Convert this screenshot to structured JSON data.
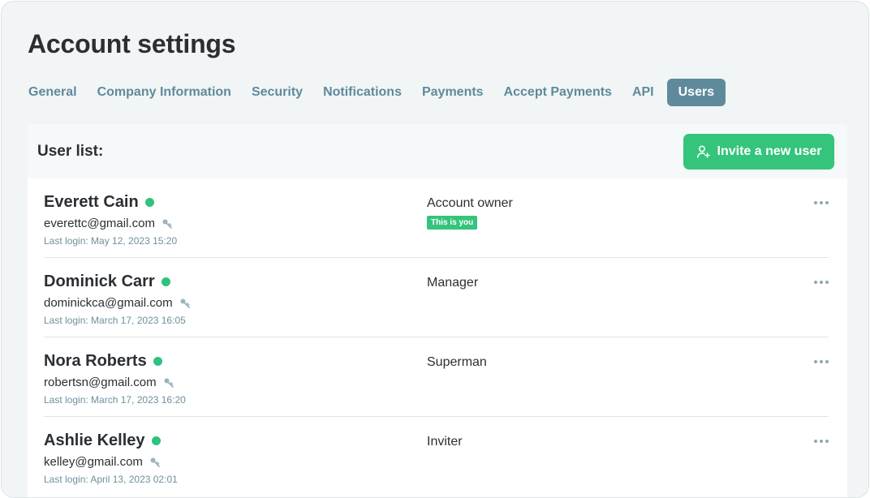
{
  "page": {
    "title": "Account settings"
  },
  "tabs": [
    {
      "label": "General",
      "active": false
    },
    {
      "label": "Company Information",
      "active": false
    },
    {
      "label": "Security",
      "active": false
    },
    {
      "label": "Notifications",
      "active": false
    },
    {
      "label": "Payments",
      "active": false
    },
    {
      "label": "Accept Payments",
      "active": false
    },
    {
      "label": "API",
      "active": false
    },
    {
      "label": "Users",
      "active": true
    }
  ],
  "user_list": {
    "title": "User list:",
    "invite_label": "Invite a new user",
    "users": [
      {
        "name": "Everett Cain",
        "email": "everettc@gmail.com",
        "last_login": "Last login: May 12, 2023 15:20",
        "role": "Account owner",
        "badge": "This is you",
        "online": true
      },
      {
        "name": "Dominick Carr",
        "email": "dominickca@gmail.com",
        "last_login": "Last login: March 17, 2023 16:05",
        "role": "Manager",
        "badge": "",
        "online": true
      },
      {
        "name": "Nora Roberts",
        "email": "robertsn@gmail.com",
        "last_login": "Last login: March 17, 2023 16:20",
        "role": "Superman",
        "badge": "",
        "online": true
      },
      {
        "name": "Ashlie Kelley",
        "email": "kelley@gmail.com",
        "last_login": "Last login: April 13, 2023 02:01",
        "role": "Inviter",
        "badge": "",
        "online": true
      }
    ]
  },
  "colors": {
    "accent": "#34c47c",
    "tab_text": "#5f8a9b",
    "tab_active_bg": "#5f8a9b",
    "online": "#2ec27e",
    "background": "#f1f5f6"
  },
  "icons": {
    "invite": "user-plus-icon",
    "password": "key-icon",
    "more": "more-horizontal-icon",
    "status": "online-status-dot"
  }
}
